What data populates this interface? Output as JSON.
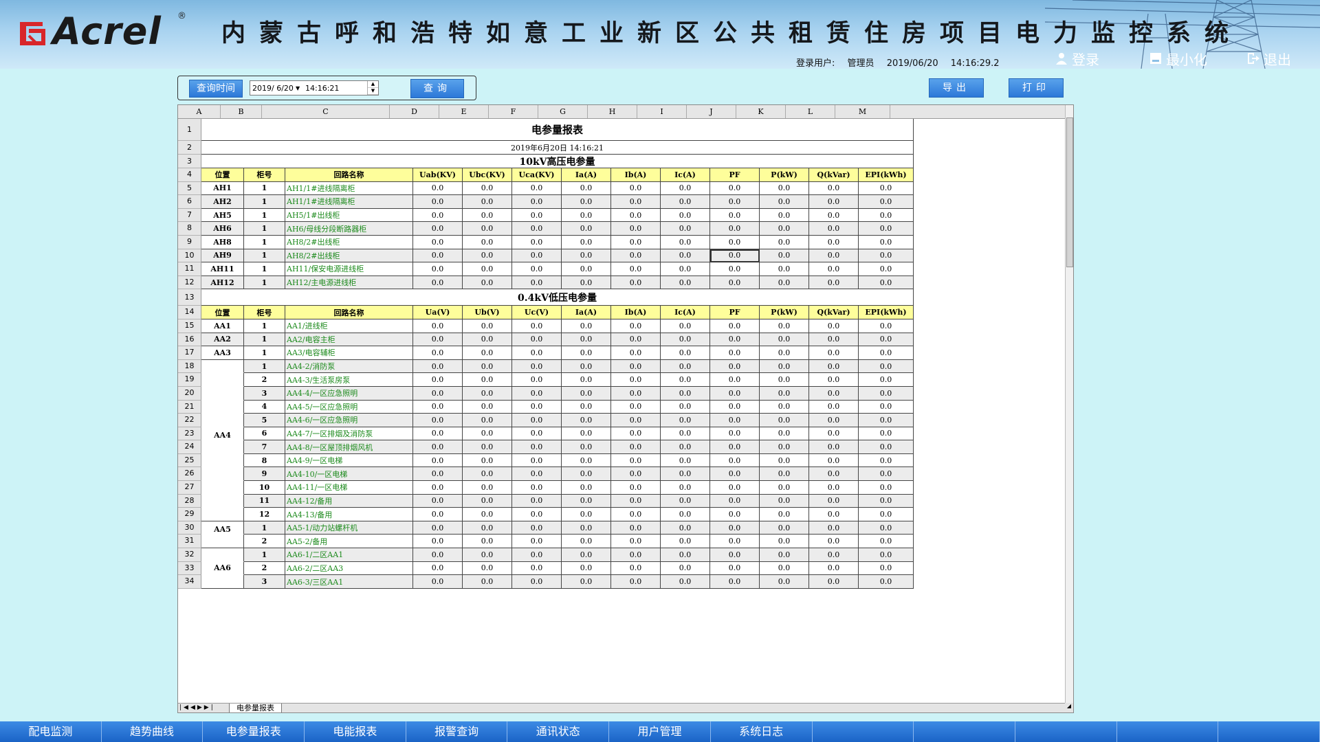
{
  "header": {
    "logo_text": "Acrel",
    "logo_reg": "®",
    "title": "内蒙古呼和浩特如意工业新区公共租赁住房项目电力监控系统",
    "user_label": "登录用户:",
    "user_name": "管理员",
    "date": "2019/06/20",
    "time": "14:16:29.2",
    "login": "登录",
    "minimize": "最小化",
    "exit": "退出"
  },
  "toolbar": {
    "query_time": "查询时间",
    "date_value": "2019/ 6/20",
    "time_value": "14:16:21",
    "query": "查询",
    "export": "导出",
    "print": "打印"
  },
  "sheet": {
    "columns": [
      "A",
      "B",
      "C",
      "D",
      "E",
      "F",
      "G",
      "H",
      "I",
      "J",
      "K",
      "L",
      "M"
    ],
    "row_numbers": [
      "1",
      "2",
      "3",
      "4",
      "5",
      "6",
      "7",
      "8",
      "9",
      "10",
      "11",
      "12",
      "13",
      "14",
      "15",
      "16",
      "17",
      "18",
      "19",
      "20",
      "21",
      "22",
      "23",
      "24",
      "25",
      "26",
      "27",
      "28",
      "29",
      "30",
      "31",
      "32",
      "33",
      "34"
    ],
    "report_title": "电参量报表",
    "report_time": "2019年6月20日 14:16:21",
    "hv_section": "10kV高压电参量",
    "lv_section": "0.4kV低压电参量",
    "hv_headers": [
      "位置",
      "柜号",
      "回路名称",
      "Uab(KV)",
      "Ubc(KV)",
      "Uca(KV)",
      "Ia(A)",
      "Ib(A)",
      "Ic(A)",
      "PF",
      "P(kW)",
      "Q(kVar)",
      "EPI(kWh)"
    ],
    "lv_headers": [
      "位置",
      "柜号",
      "回路名称",
      "Ua(V)",
      "Ub(V)",
      "Uc(V)",
      "Ia(A)",
      "Ib(A)",
      "Ic(A)",
      "PF",
      "P(kW)",
      "Q(kVar)",
      "EPI(kWh)"
    ],
    "hv_rows": [
      {
        "pos": "AH1",
        "no": "1",
        "name": "AH1/1#进线隔离柜",
        "v": [
          "0.0",
          "0.0",
          "0.0",
          "0.0",
          "0.0",
          "0.0",
          "0.0",
          "0.0",
          "0.0",
          "0.0"
        ]
      },
      {
        "pos": "AH2",
        "no": "1",
        "name": "AH1/1#进线隔离柜",
        "v": [
          "0.0",
          "0.0",
          "0.0",
          "0.0",
          "0.0",
          "0.0",
          "0.0",
          "0.0",
          "0.0",
          "0.0"
        ]
      },
      {
        "pos": "AH5",
        "no": "1",
        "name": "AH5/1#出线柜",
        "v": [
          "0.0",
          "0.0",
          "0.0",
          "0.0",
          "0.0",
          "0.0",
          "0.0",
          "0.0",
          "0.0",
          "0.0"
        ]
      },
      {
        "pos": "AH6",
        "no": "1",
        "name": "AH6/母线分段断路器柜",
        "v": [
          "0.0",
          "0.0",
          "0.0",
          "0.0",
          "0.0",
          "0.0",
          "0.0",
          "0.0",
          "0.0",
          "0.0"
        ]
      },
      {
        "pos": "AH8",
        "no": "1",
        "name": "AH8/2#出线柜",
        "v": [
          "0.0",
          "0.0",
          "0.0",
          "0.0",
          "0.0",
          "0.0",
          "0.0",
          "0.0",
          "0.0",
          "0.0"
        ]
      },
      {
        "pos": "AH9",
        "no": "1",
        "name": "AH8/2#出线柜",
        "v": [
          "0.0",
          "0.0",
          "0.0",
          "0.0",
          "0.0",
          "0.0",
          "0.0",
          "0.0",
          "0.0",
          "0.0"
        ]
      },
      {
        "pos": "AH11",
        "no": "1",
        "name": "AH11/保安电源进线柜",
        "v": [
          "0.0",
          "0.0",
          "0.0",
          "0.0",
          "0.0",
          "0.0",
          "0.0",
          "0.0",
          "0.0",
          "0.0"
        ]
      },
      {
        "pos": "AH12",
        "no": "1",
        "name": "AH12/主电源进线柜",
        "v": [
          "0.0",
          "0.0",
          "0.0",
          "0.0",
          "0.0",
          "0.0",
          "0.0",
          "0.0",
          "0.0",
          "0.0"
        ]
      }
    ],
    "lv_rows": [
      {
        "pos": "AA1",
        "no": "1",
        "name": "AA1/进线柜",
        "v": [
          "0.0",
          "0.0",
          "0.0",
          "0.0",
          "0.0",
          "0.0",
          "0.0",
          "0.0",
          "0.0",
          "0.0"
        ]
      },
      {
        "pos": "AA2",
        "no": "1",
        "name": "AA2/电容主柜",
        "v": [
          "0.0",
          "0.0",
          "0.0",
          "0.0",
          "0.0",
          "0.0",
          "0.0",
          "0.0",
          "0.0",
          "0.0"
        ]
      },
      {
        "pos": "AA3",
        "no": "1",
        "name": "AA3/电容辅柜",
        "v": [
          "0.0",
          "0.0",
          "0.0",
          "0.0",
          "0.0",
          "0.0",
          "0.0",
          "0.0",
          "0.0",
          "0.0"
        ]
      },
      {
        "pos": "AA4",
        "no": "1",
        "name": "AA4-2/消防泵",
        "v": [
          "0.0",
          "0.0",
          "0.0",
          "0.0",
          "0.0",
          "0.0",
          "0.0",
          "0.0",
          "0.0",
          "0.0"
        ]
      },
      {
        "pos": "",
        "no": "2",
        "name": "AA4-3/生活泵房泵",
        "v": [
          "0.0",
          "0.0",
          "0.0",
          "0.0",
          "0.0",
          "0.0",
          "0.0",
          "0.0",
          "0.0",
          "0.0"
        ]
      },
      {
        "pos": "",
        "no": "3",
        "name": "AA4-4/一区应急照明",
        "v": [
          "0.0",
          "0.0",
          "0.0",
          "0.0",
          "0.0",
          "0.0",
          "0.0",
          "0.0",
          "0.0",
          "0.0"
        ]
      },
      {
        "pos": "",
        "no": "4",
        "name": "AA4-5/一区应急照明",
        "v": [
          "0.0",
          "0.0",
          "0.0",
          "0.0",
          "0.0",
          "0.0",
          "0.0",
          "0.0",
          "0.0",
          "0.0"
        ]
      },
      {
        "pos": "",
        "no": "5",
        "name": "AA4-6/一区应急照明",
        "v": [
          "0.0",
          "0.0",
          "0.0",
          "0.0",
          "0.0",
          "0.0",
          "0.0",
          "0.0",
          "0.0",
          "0.0"
        ]
      },
      {
        "pos": "",
        "no": "6",
        "name": "AA4-7/一区排烟及消防泵",
        "v": [
          "0.0",
          "0.0",
          "0.0",
          "0.0",
          "0.0",
          "0.0",
          "0.0",
          "0.0",
          "0.0",
          "0.0"
        ]
      },
      {
        "pos": "",
        "no": "7",
        "name": "AA4-8/一区屋顶排烟风机",
        "v": [
          "0.0",
          "0.0",
          "0.0",
          "0.0",
          "0.0",
          "0.0",
          "0.0",
          "0.0",
          "0.0",
          "0.0"
        ]
      },
      {
        "pos": "",
        "no": "8",
        "name": "AA4-9/一区电梯",
        "v": [
          "0.0",
          "0.0",
          "0.0",
          "0.0",
          "0.0",
          "0.0",
          "0.0",
          "0.0",
          "0.0",
          "0.0"
        ]
      },
      {
        "pos": "",
        "no": "9",
        "name": "AA4-10/一区电梯",
        "v": [
          "0.0",
          "0.0",
          "0.0",
          "0.0",
          "0.0",
          "0.0",
          "0.0",
          "0.0",
          "0.0",
          "0.0"
        ]
      },
      {
        "pos": "",
        "no": "10",
        "name": "AA4-11/一区电梯",
        "v": [
          "0.0",
          "0.0",
          "0.0",
          "0.0",
          "0.0",
          "0.0",
          "0.0",
          "0.0",
          "0.0",
          "0.0"
        ]
      },
      {
        "pos": "",
        "no": "11",
        "name": "AA4-12/备用",
        "v": [
          "0.0",
          "0.0",
          "0.0",
          "0.0",
          "0.0",
          "0.0",
          "0.0",
          "0.0",
          "0.0",
          "0.0"
        ]
      },
      {
        "pos": "",
        "no": "12",
        "name": "AA4-13/备用",
        "v": [
          "0.0",
          "0.0",
          "0.0",
          "0.0",
          "0.0",
          "0.0",
          "0.0",
          "0.0",
          "0.0",
          "0.0"
        ]
      },
      {
        "pos": "AA5",
        "no": "1",
        "name": "AA5-1/动力站螺杆机",
        "v": [
          "0.0",
          "0.0",
          "0.0",
          "0.0",
          "0.0",
          "0.0",
          "0.0",
          "0.0",
          "0.0",
          "0.0"
        ]
      },
      {
        "pos": "",
        "no": "2",
        "name": "AA5-2/备用",
        "v": [
          "0.0",
          "0.0",
          "0.0",
          "0.0",
          "0.0",
          "0.0",
          "0.0",
          "0.0",
          "0.0",
          "0.0"
        ]
      },
      {
        "pos": "AA6",
        "no": "1",
        "name": "AA6-1/二区AA1",
        "v": [
          "0.0",
          "0.0",
          "0.0",
          "0.0",
          "0.0",
          "0.0",
          "0.0",
          "0.0",
          "0.0",
          "0.0"
        ]
      },
      {
        "pos": "",
        "no": "2",
        "name": "AA6-2/二区AA3",
        "v": [
          "0.0",
          "0.0",
          "0.0",
          "0.0",
          "0.0",
          "0.0",
          "0.0",
          "0.0",
          "0.0",
          "0.0"
        ]
      },
      {
        "pos": "",
        "no": "3",
        "name": "AA6-3/三区AA1",
        "v": [
          "0.0",
          "0.0",
          "0.0",
          "0.0",
          "0.0",
          "0.0",
          "0.0",
          "0.0",
          "0.0",
          "0.0"
        ]
      }
    ],
    "tab_name": "电参量报表"
  },
  "nav": [
    "配电监测",
    "趋势曲线",
    "电参量报表",
    "电能报表",
    "报警查询",
    "通讯状态",
    "用户管理",
    "系统日志",
    "",
    "",
    "",
    "",
    ""
  ],
  "colors": {
    "accent": "#2c78d8",
    "header_yellow": "#fefe9b",
    "name_green": "#1c8a1c",
    "logo_red": "#d8262a"
  }
}
